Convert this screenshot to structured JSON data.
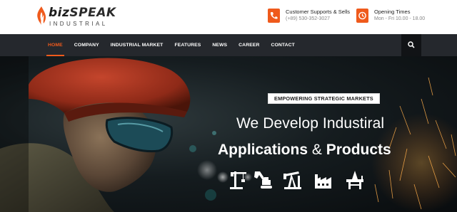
{
  "brand": {
    "name_part1": "biz",
    "name_part2": "SPEAK",
    "tagline": "INDUSTRIAL"
  },
  "contacts": [
    {
      "icon": "phone-icon",
      "title": "Customer Supports & Sells",
      "detail": "(+89) 530-352-3027"
    },
    {
      "icon": "clock-icon",
      "title": "Opening Times",
      "detail": "Mon - Fri 10.00 - 18.00"
    }
  ],
  "nav": {
    "items": [
      {
        "label": "HOME",
        "active": true
      },
      {
        "label": "COMPANY",
        "active": false
      },
      {
        "label": "INDUSTRIAL MARKET",
        "active": false
      },
      {
        "label": "FEATURES",
        "active": false
      },
      {
        "label": "NEWS",
        "active": false
      },
      {
        "label": "CAREER",
        "active": false
      },
      {
        "label": "CONTACT",
        "active": false
      }
    ],
    "search_icon": "search-icon"
  },
  "hero": {
    "tag": "EMPOWERING STRATEGIC MARKETS",
    "headline": "We Develop Industiral",
    "subheadline_1": "Applications",
    "subheadline_amp": "&",
    "subheadline_2": "Products",
    "industry_icons": [
      "crane-icon",
      "excavator-icon",
      "oil-pump-icon",
      "factory-icon",
      "oil-rig-icon"
    ]
  },
  "colors": {
    "accent": "#ef5a1c",
    "nav_bg": "#25282d",
    "text_dark": "#222222"
  }
}
